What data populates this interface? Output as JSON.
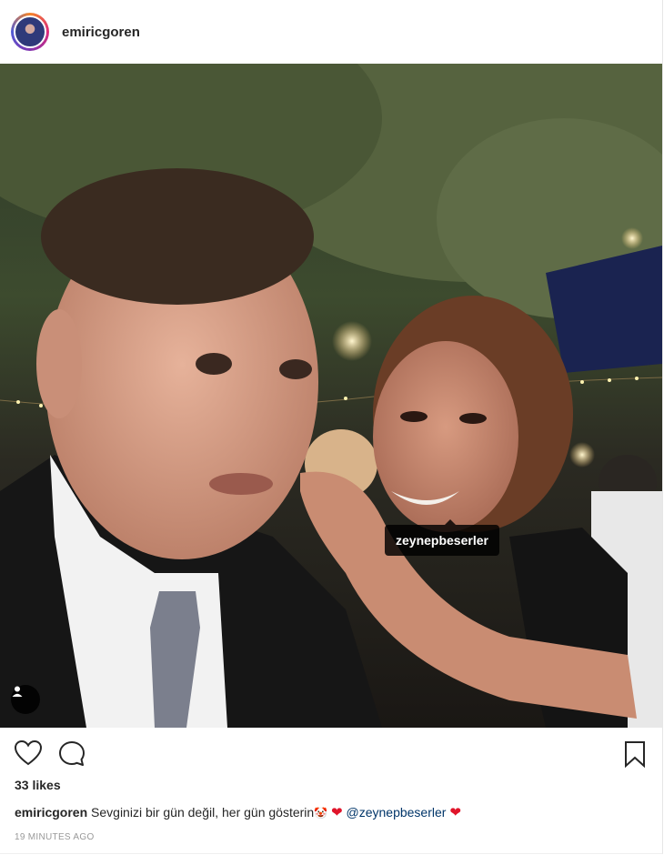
{
  "post": {
    "username": "emiricgoren",
    "photo_tag": "zeynepbeserler",
    "likes_text": "33 likes",
    "caption": {
      "username": "emiricgoren",
      "text": "Sevginizi bir gün değil, her gün gösterin",
      "emoji_face": "🤡",
      "emoji_heart": "❤",
      "mention": "@zeynepbeserler",
      "emoji_heart_2": "❤"
    },
    "timestamp": "19 MINUTES AGO"
  },
  "icons": {
    "like": "heart-outline-icon",
    "comment": "comment-bubble-icon",
    "save": "bookmark-icon",
    "tagged_users": "user-tag-icon"
  },
  "colors": {
    "text": "#262626",
    "muted": "#999999",
    "mention": "#003569",
    "heart": "#e0142a",
    "tag_bubble": "#000000"
  }
}
